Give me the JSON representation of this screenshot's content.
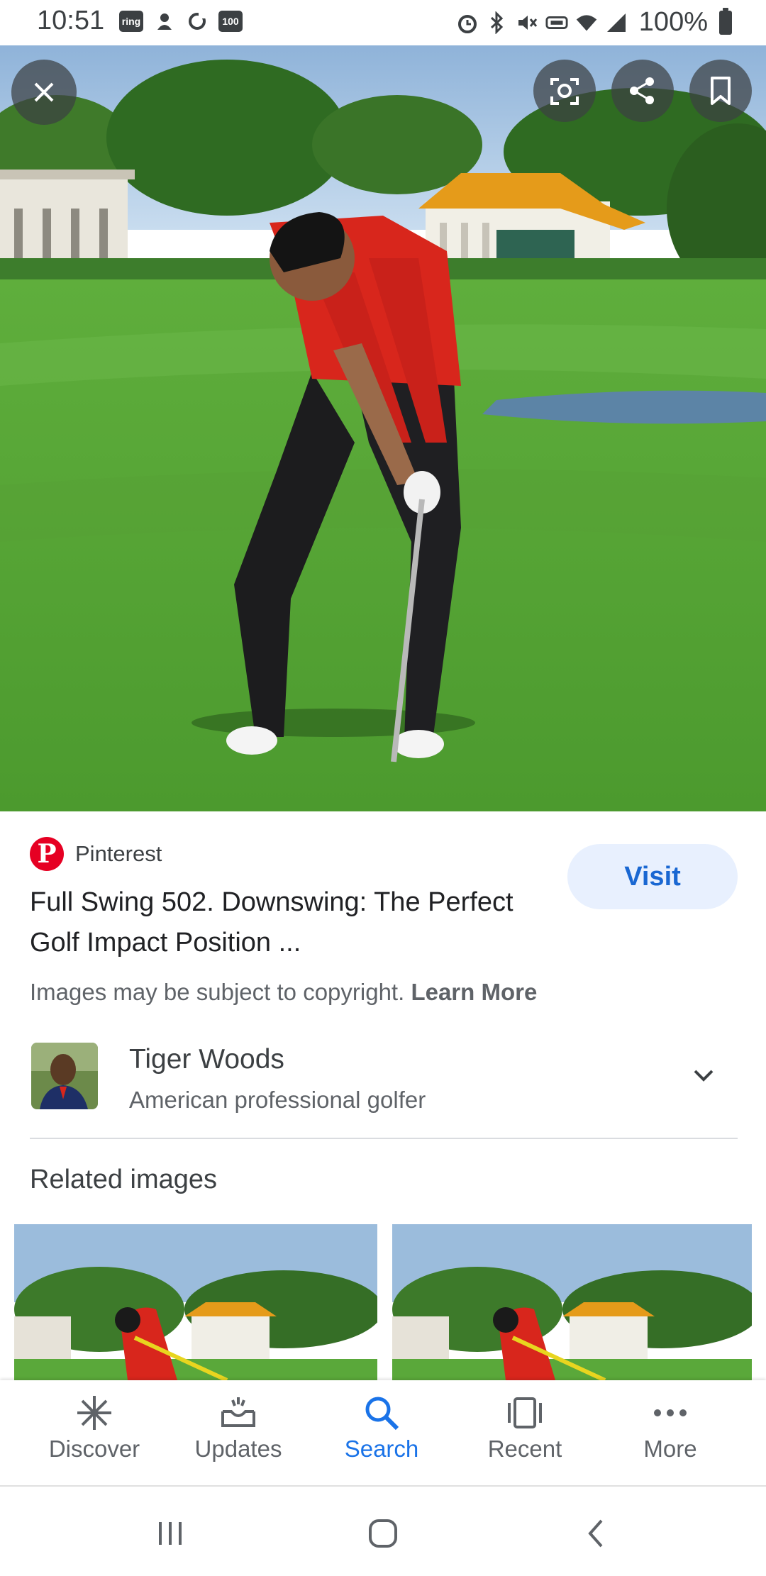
{
  "status_bar": {
    "time": "10:51",
    "left_icons": [
      "ring-app-icon",
      "notification-icon",
      "sync-icon",
      "badge-100-icon"
    ],
    "left_icon_text": [
      "ring",
      "100"
    ],
    "right_icons": [
      "alarm-icon",
      "bluetooth-icon",
      "mute-icon",
      "volte-icon",
      "wifi-icon",
      "signal-icon"
    ],
    "battery_text": "100%"
  },
  "hero": {
    "buttons": [
      "close-icon",
      "lens-icon",
      "share-icon",
      "bookmark-icon"
    ]
  },
  "source": {
    "name": "Pinterest",
    "logo_letter": "P",
    "brand_color": "#e60023"
  },
  "visit_label": "Visit",
  "title": "Full Swing 502. Downswing: The Perfect Golf Impact Position ...",
  "copyright": {
    "text": "Images may be subject to copyright.",
    "link": "Learn More"
  },
  "entity": {
    "name": "Tiger Woods",
    "description": "American professional golfer"
  },
  "related": {
    "title": "Related images"
  },
  "bottom_nav": {
    "items": [
      {
        "label": "Discover",
        "icon": "asterisk-icon",
        "active": false
      },
      {
        "label": "Updates",
        "icon": "updates-tray-icon",
        "active": false
      },
      {
        "label": "Search",
        "icon": "search-icon",
        "active": true
      },
      {
        "label": "Recent",
        "icon": "recent-icon",
        "active": false
      },
      {
        "label": "More",
        "icon": "more-dots-icon",
        "active": false
      }
    ],
    "accent": "#1a73e8"
  },
  "system_nav": [
    "recents-button",
    "home-button",
    "back-button"
  ]
}
